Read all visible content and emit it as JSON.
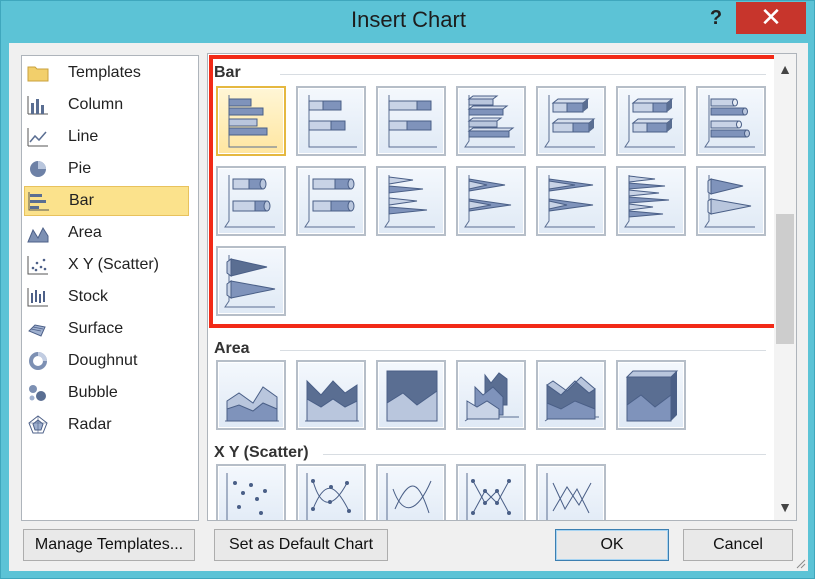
{
  "window": {
    "title": "Insert Chart",
    "help_label": "?",
    "close_label": "✕"
  },
  "sidebar": {
    "items": [
      {
        "label": "Templates",
        "icon": "folder-icon"
      },
      {
        "label": "Column",
        "icon": "column-chart-icon"
      },
      {
        "label": "Line",
        "icon": "line-chart-icon"
      },
      {
        "label": "Pie",
        "icon": "pie-chart-icon"
      },
      {
        "label": "Bar",
        "icon": "bar-chart-icon",
        "selected": true
      },
      {
        "label": "Area",
        "icon": "area-chart-icon"
      },
      {
        "label": "X Y (Scatter)",
        "icon": "scatter-chart-icon"
      },
      {
        "label": "Stock",
        "icon": "stock-chart-icon"
      },
      {
        "label": "Surface",
        "icon": "surface-chart-icon"
      },
      {
        "label": "Doughnut",
        "icon": "doughnut-chart-icon"
      },
      {
        "label": "Bubble",
        "icon": "bubble-chart-icon"
      },
      {
        "label": "Radar",
        "icon": "radar-chart-icon"
      }
    ]
  },
  "gallery": {
    "sections": [
      {
        "title": "Bar",
        "tile_count": 15,
        "selected_index": 0
      },
      {
        "title": "Area",
        "tile_count": 6
      },
      {
        "title": "X Y (Scatter)",
        "tile_count": 5
      }
    ]
  },
  "buttons": {
    "manage_templates": "Manage Templates...",
    "set_default": "Set as Default Chart",
    "ok": "OK",
    "cancel": "Cancel"
  },
  "colors": {
    "window_frame": "#5cc3d6",
    "close_button": "#c7352c",
    "selection_fill": "#fbe28c",
    "highlight_box": "#f22a17"
  }
}
